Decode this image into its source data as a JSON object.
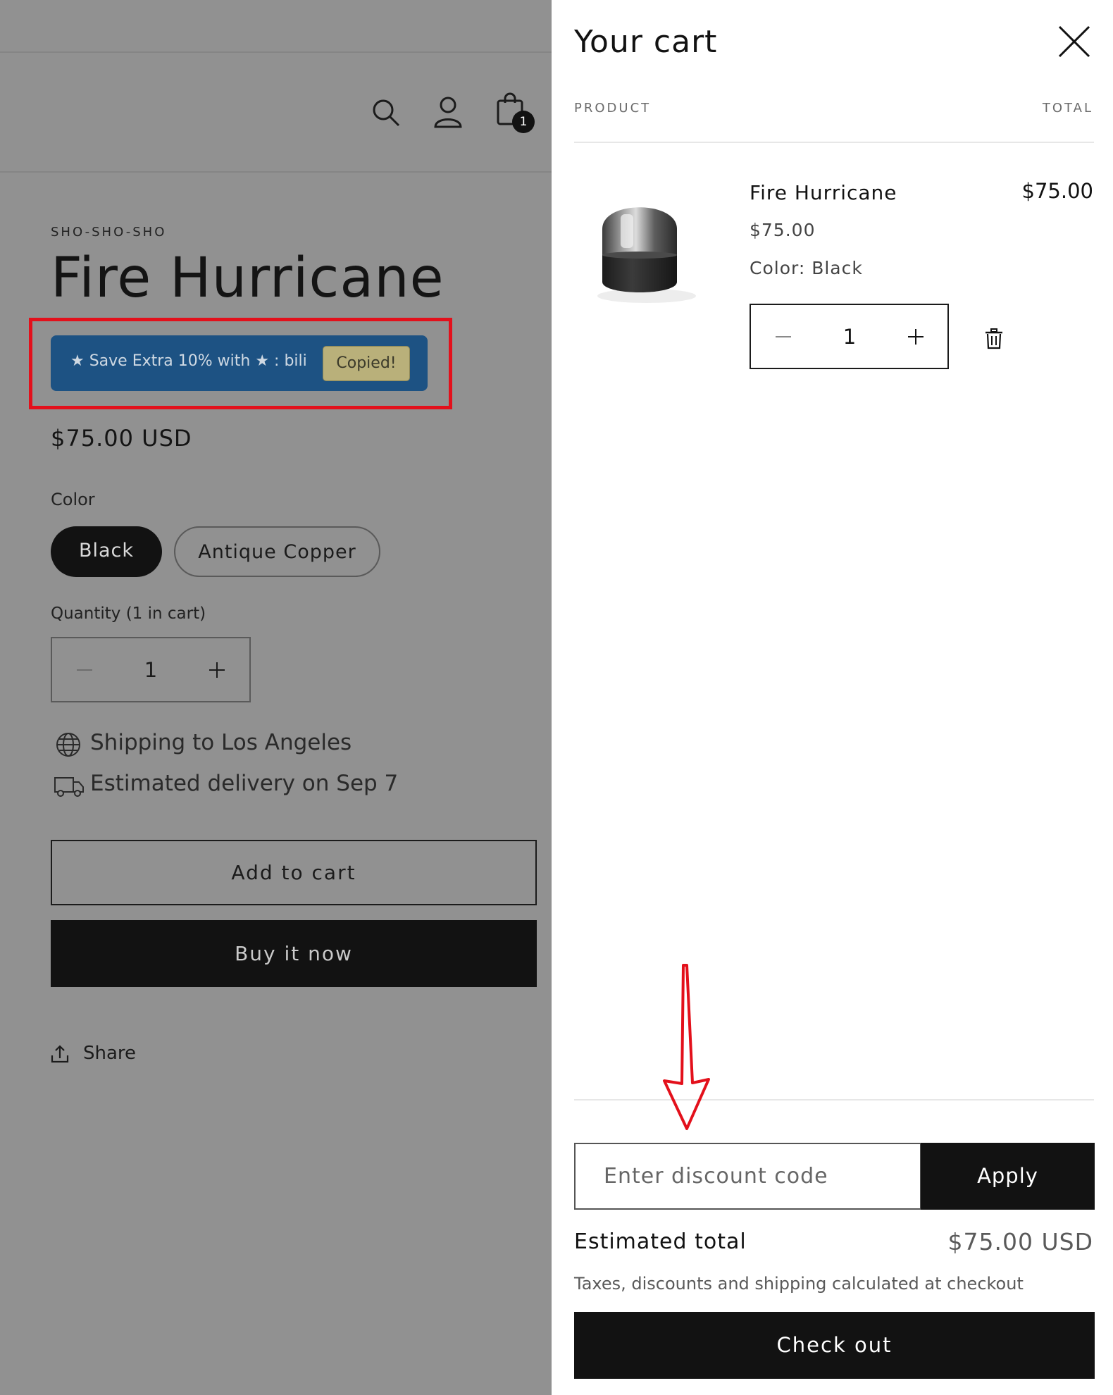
{
  "overlay": {
    "header_icons": [
      "search-icon",
      "account-icon",
      "cart-icon"
    ],
    "cart_count": "1"
  },
  "product": {
    "vendor": "SHO-SHO-SHO",
    "title": "Fire Hurricane",
    "promo": {
      "text": "★ Save Extra 10% with ★ :  bili",
      "copied_label": "Copied!",
      "bg_color": "#1d5283"
    },
    "price": "$75.00 USD",
    "color_label": "Color",
    "colors": [
      "Black",
      "Antique Copper"
    ],
    "selected_color": "Black",
    "quantity_label": "Quantity (1 in cart)",
    "quantity": "1",
    "shipping_text": "Shipping to Los Angeles",
    "delivery_text": "Estimated delivery on Sep 7",
    "add_to_cart_label": "Add to cart",
    "buy_now_label": "Buy it now",
    "share_label": "Share"
  },
  "cart": {
    "title": "Your cart",
    "col_product": "PRODUCT",
    "col_total": "TOTAL",
    "item": {
      "name": "Fire Hurricane",
      "price": "$75.00",
      "color": "Color: Black",
      "quantity": "1",
      "total": "$75.00"
    },
    "discount_placeholder": "Enter discount code",
    "apply_label": "Apply",
    "estimated_label": "Estimated total",
    "estimated_value": "$75.00 USD",
    "tax_note": "Taxes, discounts and shipping calculated at checkout",
    "checkout_label": "Check out"
  },
  "annotation_color": "#e3101b"
}
